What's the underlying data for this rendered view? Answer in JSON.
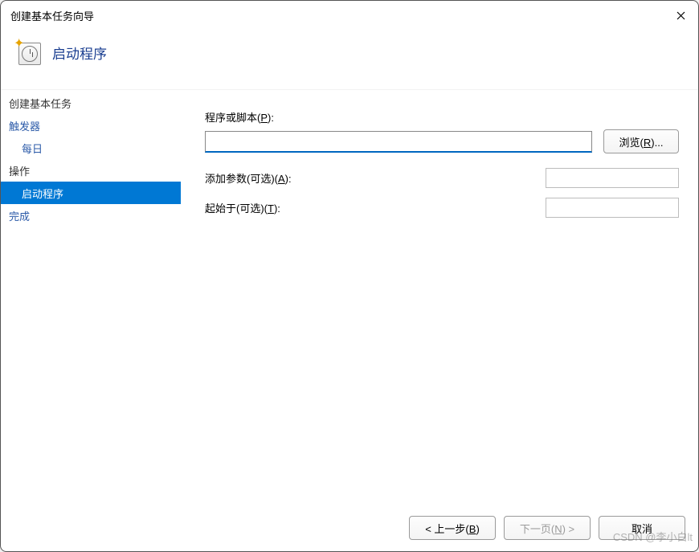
{
  "window": {
    "title": "创建基本任务向导"
  },
  "header": {
    "page_title": "启动程序"
  },
  "sidebar": {
    "items": [
      {
        "label": "创建基本任务",
        "plain": true
      },
      {
        "label": "触发器"
      },
      {
        "label": "每日",
        "sub": true
      },
      {
        "label": "操作",
        "plain": true
      },
      {
        "label": "启动程序",
        "sub": true,
        "active": true
      },
      {
        "label": "完成"
      }
    ]
  },
  "form": {
    "program_label_pre": "程序或脚本(",
    "program_label_u": "P",
    "program_label_post": "):",
    "program_value": "",
    "browse_pre": "浏览(",
    "browse_u": "R",
    "browse_post": ")...",
    "args_label_pre": "添加参数(可选)(",
    "args_label_u": "A",
    "args_label_post": "):",
    "args_value": "",
    "startin_label_pre": "起始于(可选)(",
    "startin_label_u": "T",
    "startin_label_post": "):",
    "startin_value": ""
  },
  "footer": {
    "back_pre": "< 上一步(",
    "back_u": "B",
    "back_post": ")",
    "next_pre": "下一页(",
    "next_u": "N",
    "next_post": ") >",
    "cancel": "取消"
  },
  "watermark": "CSDN @李小白lt"
}
